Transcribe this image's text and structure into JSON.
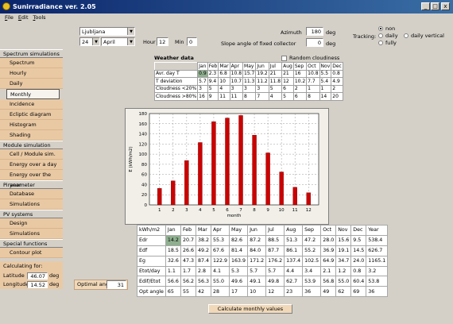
{
  "window": {
    "title": "Sunirradiance ver. 2.05",
    "minimize": "_",
    "maximize": "□",
    "close": "x"
  },
  "menu": [
    "File",
    "Edit",
    "Tools"
  ],
  "controls": {
    "location": "Ljubljana",
    "day": "24",
    "month": "April",
    "hour_label": "Hour",
    "hour": "12",
    "min_label": "Min",
    "min": "0",
    "azimuth_label": "Azimuth",
    "azimuth": "180",
    "azimuth_unit": "deg",
    "slope_label": "Slope angle of fixed collector",
    "slope": "0",
    "slope_unit": "deg",
    "tracking_label": "Tracking:",
    "tracking_options": [
      "non",
      "daily",
      "fully",
      "daily vertical"
    ],
    "tracking_selected": "non"
  },
  "sidebar": {
    "sections": [
      {
        "title": "Spectrum simulations",
        "items": [
          "Spectrum",
          "Hourly",
          "Daily",
          "Monthly",
          "Incidence",
          "Ecliptic diagram",
          "Histogram",
          "Shading"
        ]
      },
      {
        "title": "Module simulation",
        "items": [
          "Cell / Module sim.",
          "Energy over a day",
          "Energy over the year"
        ]
      },
      {
        "title": "Piranometer",
        "items": [
          "Database",
          "Simulations"
        ]
      },
      {
        "title": "PV systems",
        "items": [
          "Design",
          "Simulations"
        ]
      },
      {
        "title": "Special functions",
        "items": [
          "Contour plot"
        ]
      }
    ],
    "active": "Monthly",
    "calc_for": "Calculating for: Ljubljana",
    "latitude_label": "Latitude",
    "latitude": "46.07",
    "longitude_label": "Longitude",
    "longitude": "14.52",
    "deg": "deg"
  },
  "weather": {
    "title": "Weather data",
    "random_cloudiness": "Random cloudiness",
    "months": [
      "Jan",
      "Feb",
      "Mar",
      "Apr",
      "May",
      "Jun",
      "Jul",
      "Aug",
      "Sep",
      "Oct",
      "Nov",
      "Dec"
    ],
    "rows": [
      {
        "label": "Avr. day T",
        "values": [
          "0.9",
          "2.3",
          "6.8",
          "10.8",
          "15.7",
          "19.2",
          "21",
          "21",
          "16",
          "10.8",
          "5.5",
          "0.8"
        ]
      },
      {
        "label": "T deviation",
        "values": [
          "5.7",
          "9.4",
          "10",
          "10.7",
          "11.3",
          "11.2",
          "11.8",
          "12",
          "10.2",
          "7.7",
          "5.4",
          "4.9"
        ]
      },
      {
        "label": "Cloudness <20%",
        "values": [
          "3",
          "5",
          "4",
          "3",
          "3",
          "3",
          "5",
          "6",
          "2",
          "1",
          "1",
          "2"
        ]
      },
      {
        "label": "Cloudness >80%",
        "values": [
          "16",
          "9",
          "11",
          "11",
          "8",
          "7",
          "4",
          "5",
          "6",
          "8",
          "14",
          "20"
        ]
      }
    ]
  },
  "chart_data": {
    "type": "bar",
    "categories": [
      "1",
      "2",
      "3",
      "4",
      "5",
      "6",
      "7",
      "8",
      "9",
      "10",
      "11",
      "12"
    ],
    "values": [
      32.6,
      47.3,
      87.4,
      122.9,
      163.9,
      171.2,
      176.2,
      137.4,
      102.5,
      64.9,
      34.7,
      24.0
    ],
    "xlabel": "month",
    "ylabel": "E (kWh/m2)",
    "ylim": [
      0,
      180
    ],
    "yticks": [
      "0",
      "20",
      "40",
      "60",
      "80",
      "100",
      "120",
      "140",
      "160",
      "180"
    ],
    "grid": true,
    "bar_color": "#cc0000"
  },
  "results": {
    "header": [
      "kWh/m2",
      "Jan",
      "Feb",
      "Mar",
      "Apr",
      "May",
      "Jun",
      "Jul",
      "Aug",
      "Sep",
      "Oct",
      "Nov",
      "Dec",
      "Year"
    ],
    "rows": [
      [
        "Edr",
        "14.2",
        "20.7",
        "38.2",
        "55.3",
        "82.6",
        "87.2",
        "88.5",
        "51.3",
        "47.2",
        "28.0",
        "15.6",
        "9.5",
        "538.4"
      ],
      [
        "Edf",
        "18.5",
        "26.6",
        "49.2",
        "67.6",
        "81.4",
        "84.0",
        "87.7",
        "86.1",
        "55.2",
        "36.9",
        "19.1",
        "14.5",
        "626.7"
      ],
      [
        "Eg",
        "32.6",
        "47.3",
        "87.4",
        "122.9",
        "163.9",
        "171.2",
        "176.2",
        "137.4",
        "102.5",
        "64.9",
        "34.7",
        "24.0",
        "1165.1"
      ],
      [
        "Etot/day",
        "1.1",
        "1.7",
        "2.8",
        "4.1",
        "5.3",
        "5.7",
        "5.7",
        "4.4",
        "3.4",
        "2.1",
        "1.2",
        "0.8",
        "3.2"
      ],
      [
        "Edif/Etot",
        "56.6",
        "56.2",
        "56.3",
        "55.0",
        "49.6",
        "49.1",
        "49.8",
        "62.7",
        "53.9",
        "56.8",
        "55.0",
        "60.4",
        "53.8"
      ],
      [
        "Opt angle",
        "65",
        "55",
        "42",
        "28",
        "17",
        "10",
        "12",
        "23",
        "36",
        "49",
        "62",
        "69",
        "36"
      ]
    ]
  },
  "optimal": {
    "label": "Optimal angle",
    "value": "31"
  },
  "calc_button": "Calculate monthly values"
}
